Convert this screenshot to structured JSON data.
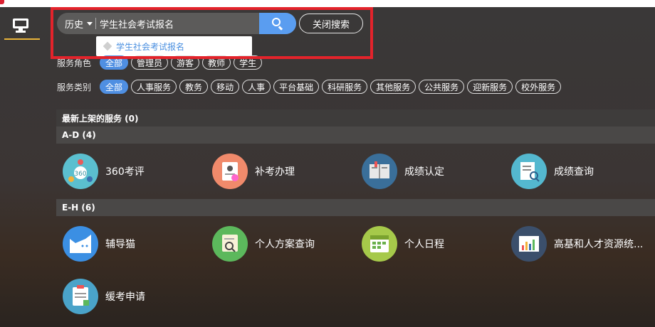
{
  "search": {
    "history_label": "历史",
    "query": "学生社会考试报名",
    "close_label": "关闭搜索",
    "suggestion": "学生社会考试报名"
  },
  "filters": {
    "role_label": "服务角色",
    "roles": [
      "全部",
      "管理员",
      "游客",
      "教师",
      "学生"
    ],
    "category_label": "服务类别",
    "categories": [
      "全部",
      "人事服务",
      "教务",
      "移动",
      "人事",
      "平台基础",
      "科研服务",
      "其他服务",
      "公共服务",
      "迎新服务",
      "校外服务"
    ]
  },
  "sections": {
    "newest": "最新上架的服务 (0)",
    "ad": "A-D (4)",
    "eh": "E-H (6)"
  },
  "services": [
    {
      "name": "360考评",
      "icon": "360-review-icon",
      "color": "#5bbfcf"
    },
    {
      "name": "补考办理",
      "icon": "makeup-exam-icon",
      "color": "#f08a6b"
    },
    {
      "name": "成绩认定",
      "icon": "grade-book-icon",
      "color": "#3a6f9a"
    },
    {
      "name": "成绩查询",
      "icon": "grade-search-icon",
      "color": "#54b8cf"
    },
    {
      "name": "辅导猫",
      "icon": "tutor-cat-icon",
      "color": "#3b8fe3"
    },
    {
      "name": "个人方案查询",
      "icon": "plan-search-icon",
      "color": "#5cb85c"
    },
    {
      "name": "个人日程",
      "icon": "calendar-icon",
      "color": "#a6c94a"
    },
    {
      "name": "高基和人才资源统...",
      "icon": "stats-chart-icon",
      "color": "#3b4f6b"
    },
    {
      "name": "缓考申请",
      "icon": "defer-exam-icon",
      "color": "#4aa3c9"
    }
  ],
  "colors": {
    "accent": "#4f8fe2",
    "highlight_box": "#e3232b",
    "rail_underline": "#e9b43a"
  }
}
